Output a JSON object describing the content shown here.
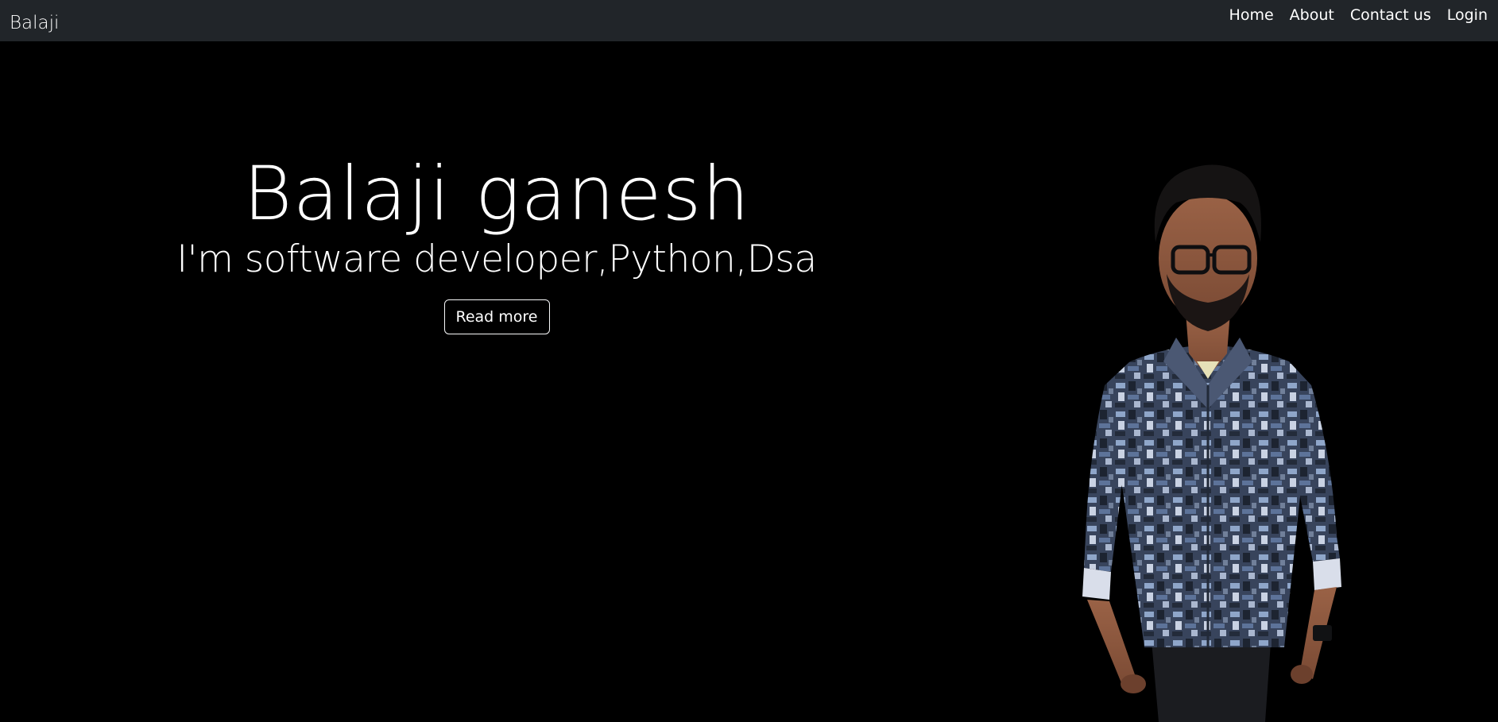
{
  "navbar": {
    "brand": "Balaji",
    "links": [
      {
        "label": "Home"
      },
      {
        "label": "About"
      },
      {
        "label": "Contact us"
      },
      {
        "label": "Login"
      }
    ],
    "background": "#212529"
  },
  "hero": {
    "title": "Balaji ganesh",
    "subtitle": "I'm software developer,Python,Dsa",
    "button_label": "Read more",
    "background": "#000000"
  },
  "portrait": {
    "icon": "person-photo",
    "shirt_color": "#3b4a68"
  }
}
